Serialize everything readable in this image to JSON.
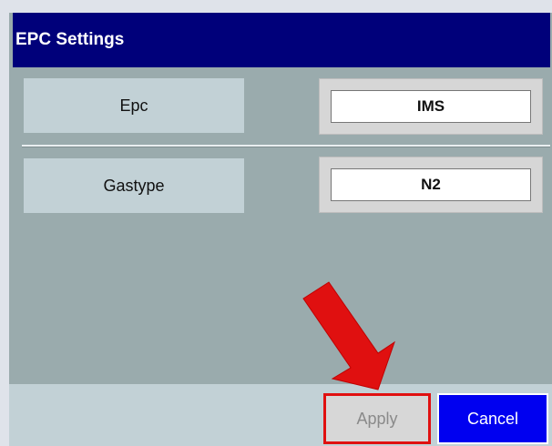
{
  "dialog": {
    "title": "EPC Settings"
  },
  "rows": [
    {
      "label": "Epc",
      "value": "IMS"
    },
    {
      "label": "Gastype",
      "value": "N2"
    }
  ],
  "buttons": {
    "apply": "Apply",
    "cancel": "Cancel"
  },
  "colors": {
    "title_bar": "#00007a",
    "dialog_bg": "#9aabad",
    "label_bg": "#c2d1d6",
    "cancel_bg": "#0000f0",
    "highlight": "#e01010"
  },
  "annotation": {
    "icon": "red-arrow-icon"
  }
}
